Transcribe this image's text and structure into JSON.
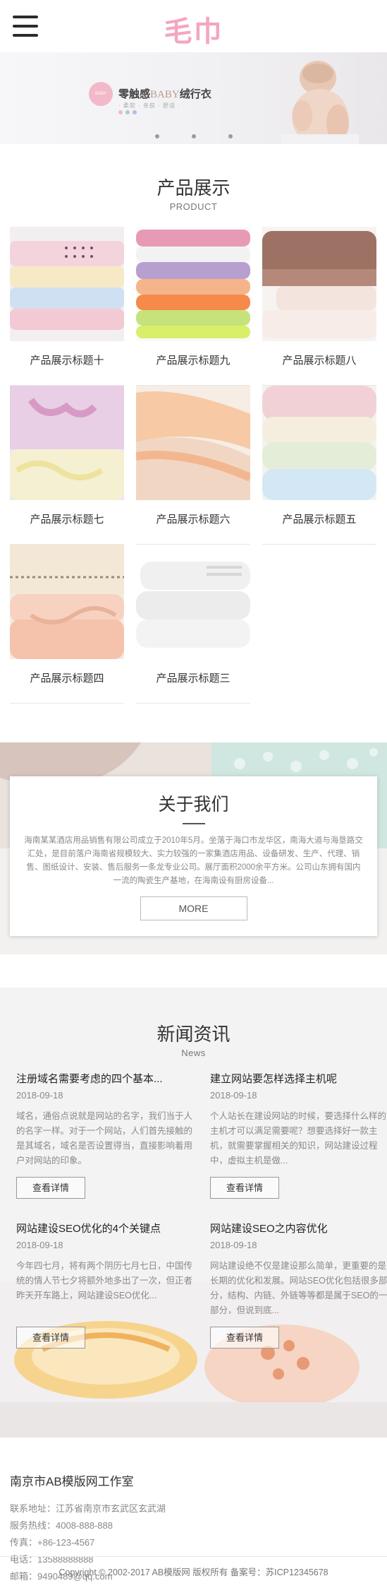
{
  "header": {
    "logo": "毛巾",
    "menu_icon": "hamburger-menu-icon"
  },
  "banner": {
    "circle_text": "BABY",
    "title_cn": "零触感",
    "title_en": "BABY",
    "title_cn2": "绒行衣",
    "subtitle": "· 柔软 · 亲肤 · 舒适 ·",
    "swatch_colors": [
      "#f3b8c9",
      "#9fd3c7",
      "#b9b9e6"
    ]
  },
  "products": {
    "title": "产品展示",
    "subtitle": "PRODUCT",
    "items": [
      {
        "label": "产品展示标题十"
      },
      {
        "label": "产品展示标题九"
      },
      {
        "label": "产品展示标题八"
      },
      {
        "label": "产品展示标题七"
      },
      {
        "label": "产品展示标题六"
      },
      {
        "label": "产品展示标题五"
      },
      {
        "label": "产品展示标题四"
      },
      {
        "label": "产品展示标题三"
      }
    ]
  },
  "about": {
    "title": "关于我们",
    "text": "海南某某酒店用品销售有限公司成立于2010年5月。坐落于海口市龙华区，南海大道与海垦路交汇处，是目前落户海南省规模较大、实力较强的一家集酒店用品、设备研发、生产、代理、销售、图纸设计、安装、售后服务一条龙专业公司。展厅面积2000余平方米。公司山东拥有国内一流的陶瓷生产基地，在海南设有厨房设备...",
    "more": "MORE"
  },
  "news": {
    "title": "新闻资讯",
    "subtitle": "News",
    "items": [
      {
        "title": "注册域名需要考虑的四个基本...",
        "date": "2018-09-18",
        "desc": "域名，通俗点说就是网站的名字，我们当于人的名字一样。对于一个网站，人们首先接触的是其域名，域名是否设置得当，直接影响着用户对网站的印象。",
        "button": "查看详情"
      },
      {
        "title": "建立网站要怎样选择主机呢",
        "date": "2018-09-18",
        "desc": "个人站长在建设网站的时候，要选择什么样的主机才可以满足需要呢？想要选择好一款主机，就需要掌握相关的知识，网站建设过程中，虚拟主机是做...",
        "button": "查看详情"
      },
      {
        "title": "网站建设SEO优化的4个关键点",
        "date": "2018-09-18",
        "desc": "今年四七月，将有两个阴历七月七日，中国传统的情人节七夕将额外地多出了一次，但正者昨天开车路上，网站建设SEO优化...",
        "button": "查看详情"
      },
      {
        "title": "网站建设SEO之内容优化",
        "date": "2018-09-18",
        "desc": "网站建设绝不仅是建设那么简单，更重要的是长期的优化和发展。网站SEO优化包括很多部分，结构、内链、外链等等都是属于SEO的一部分，但说到底...",
        "button": "查看详情"
      }
    ]
  },
  "footer": {
    "company": "南京市AB模版网工作室",
    "address": "联系地址：江苏省南京市玄武区玄武湖",
    "hotline": "服务热线：4008-888-888",
    "fax": "传真：+86-123-4567",
    "phone": "电话：13588888888",
    "email": "邮箱：9490489@qq.com",
    "copyright": "Copyright © 2002-2017 AB模版网 版权所有  备案号：苏ICP12345678"
  }
}
